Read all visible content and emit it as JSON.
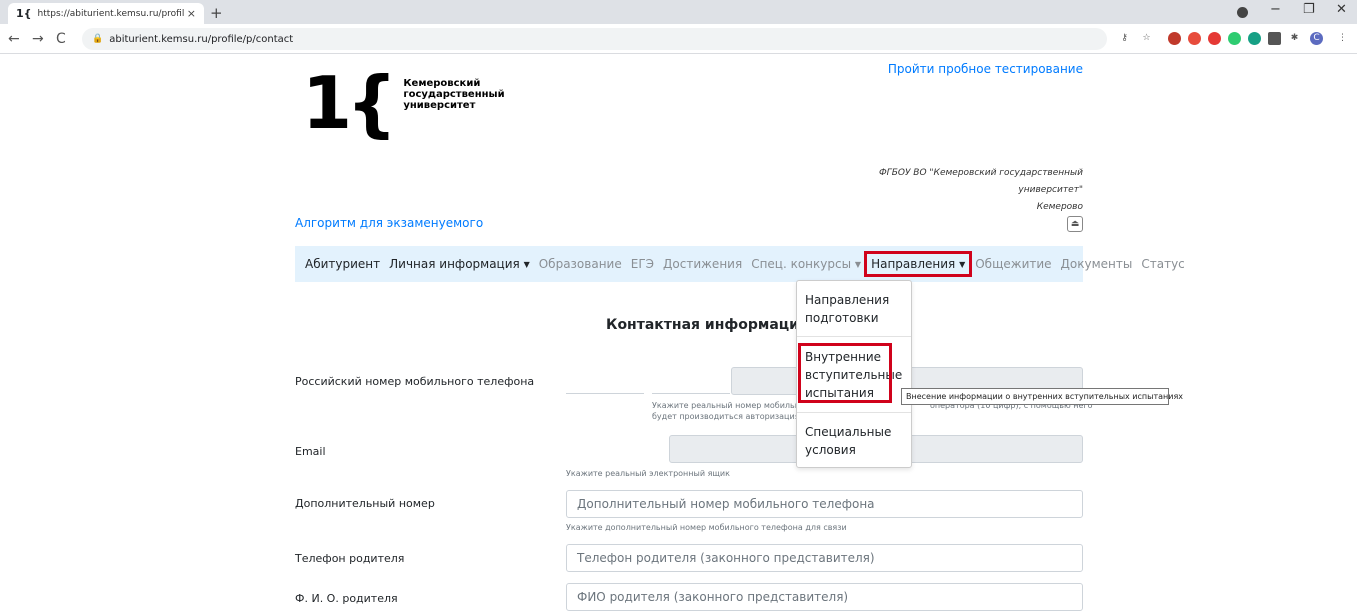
{
  "browser": {
    "tab_title": "https://abiturient.kemsu.ru/profil",
    "tab_favicon": "1{",
    "tab_close": "×",
    "new_tab": "+",
    "url": "abiturient.kemsu.ru/profile/p/contact",
    "nav": {
      "back": "←",
      "forward": "→",
      "reload": "C"
    },
    "window_controls": {
      "minimize": "−",
      "restore": "❐",
      "close": "✕"
    }
  },
  "header": {
    "logo_mark": "1{",
    "logo_line1": "Кемеровский",
    "logo_line2": "государственный",
    "logo_line3": "университет",
    "trial_link": "Пройти пробное тестирование",
    "org_line1": "ФГБОУ ВО \"Кемеровский государственный",
    "org_line2": "университет\"",
    "org_line3": "Кемерово",
    "algorithm_link": "Алгоритм для экзаменуемого"
  },
  "navbar": {
    "items": [
      {
        "label": "Абитуриент"
      },
      {
        "label": "Личная информация"
      },
      {
        "label": "Образование"
      },
      {
        "label": "ЕГЭ"
      },
      {
        "label": "Достижения"
      },
      {
        "label": "Спец. конкурсы"
      },
      {
        "label": "Направления"
      },
      {
        "label": "Общежитие"
      },
      {
        "label": "Документы"
      },
      {
        "label": "Статус"
      }
    ]
  },
  "dropdown": {
    "item1_l1": "Направления",
    "item1_l2": "подготовки",
    "item2_l1": "Внутренние",
    "item2_l2": "вступительные",
    "item2_l3": "испытания",
    "item3_l1": "Специальные",
    "item3_l2": "условия"
  },
  "tooltip": "Внесение информации о внутренних вступительных испытаниях",
  "form": {
    "title": "Контактная информация",
    "phone_label": "Российский номер мобильного телефона",
    "phone_help_l1": "Укажите реальный номер мобильн",
    "phone_help_l1b": "оператора (10 цифр), с помощью него",
    "phone_help_l2": "будет производиться авторизация",
    "email_label": "Email",
    "email_help": "Укажите реальный электронный ящик",
    "extra_label": "Дополнительный номер",
    "extra_placeholder": "Дополнительный номер мобильного телефона",
    "extra_help": "Укажите дополнительный номер мобильного телефона для связи",
    "parent_phone_label": "Телефон родителя",
    "parent_phone_placeholder": "Телефон родителя (законного представителя)",
    "parent_name_label": "Ф. И. О. родителя",
    "parent_name_placeholder": "ФИО родителя (законного представителя)"
  },
  "colors": {
    "link": "#007bff",
    "navbar_bg": "#e3f2fd",
    "highlight": "#d0021b"
  }
}
